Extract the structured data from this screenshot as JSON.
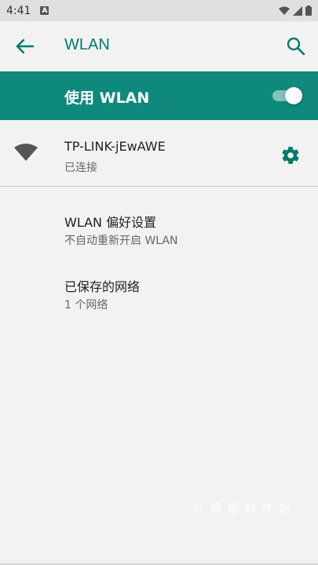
{
  "status_bar": {
    "time": "4:41",
    "app_badge": "A",
    "icons": [
      "wifi-signal-icon",
      "cellular-signal-icon",
      "battery-icon"
    ]
  },
  "app_bar": {
    "title": "WLAN",
    "back_icon": "arrow-back-icon",
    "search_icon": "search-icon"
  },
  "master_switch": {
    "label": "使用 WLAN",
    "enabled": true
  },
  "connected_network": {
    "name": "TP-LINK-jEwAWE",
    "status": "已连接",
    "icon": "wifi-signal-icon",
    "settings_icon": "gear-icon"
  },
  "preferences": [
    {
      "title": "WLAN 偏好设置",
      "subtitle": "不自动重新开启 WLAN"
    },
    {
      "title": "已保存的网络",
      "subtitle": "1 个网络"
    }
  ],
  "watermark": "什 算 都 软 件 站",
  "colors": {
    "accent": "#00796b",
    "switch_bar": "#0f897c",
    "background": "#f2f2f2"
  }
}
